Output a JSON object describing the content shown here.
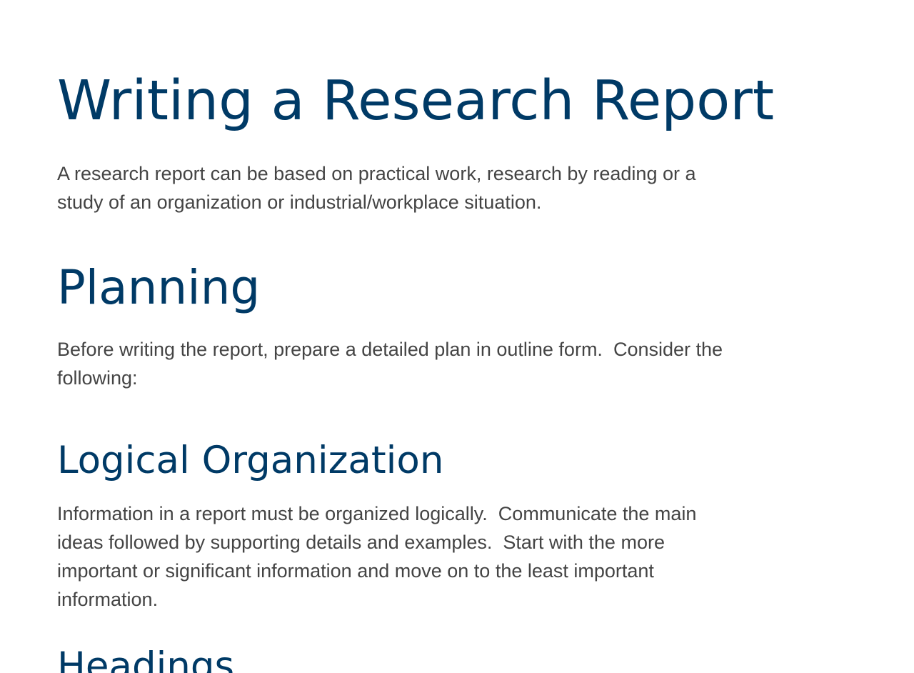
{
  "document": {
    "title": "Writing a Research Report",
    "intro": "A research report can be based on practical work, research by reading or a\nstudy of an organization or industrial/workplace situation.",
    "sections": [
      {
        "heading": "Planning",
        "text": "Before writing the report, prepare a detailed plan in outline form.  Consider the\nfollowing:"
      },
      {
        "heading": "Logical Organization",
        "text": "Information in a report must be organized logically.  Communicate the main\nideas followed by supporting details and examples.  Start with the more\nimportant or significant information and move on to the least important\ninformation."
      },
      {
        "heading": "Headings",
        "text": ""
      }
    ]
  },
  "colors": {
    "heading": "#003a66",
    "body_text": "#444444",
    "background": "#ffffff"
  }
}
